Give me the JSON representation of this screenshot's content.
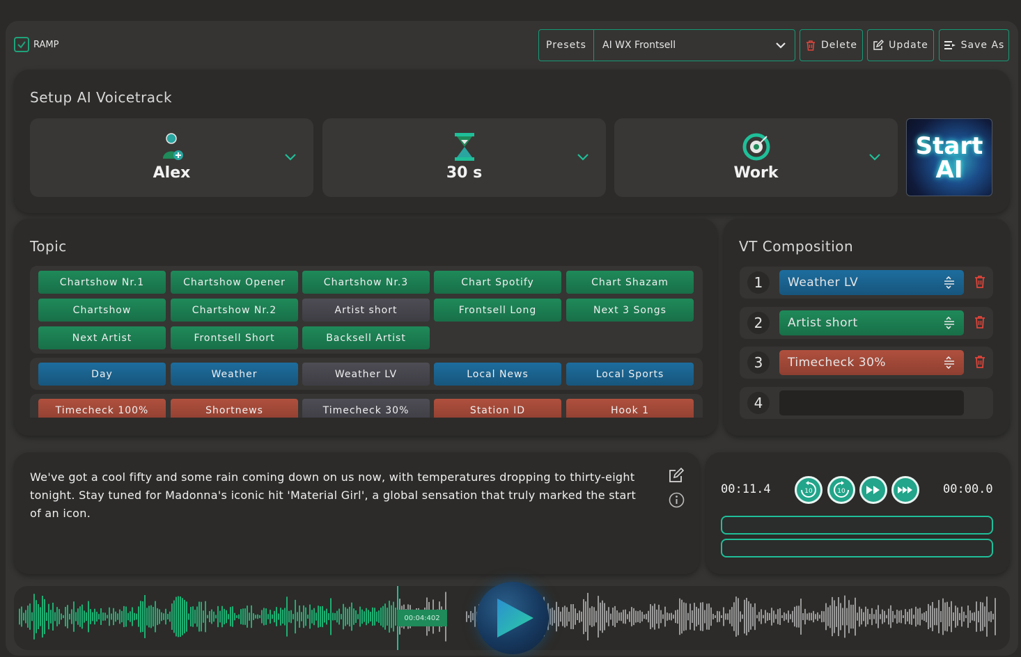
{
  "toolbar": {
    "ramp_label": "RAMP",
    "ramp_checked": true,
    "presets_label": "Presets",
    "preset_value": "AI WX Frontsell",
    "delete_label": "Delete",
    "update_label": "Update",
    "save_as_label": "Save As"
  },
  "setup": {
    "title": "Setup AI Voicetrack",
    "voice": "Alex",
    "duration": "30 s",
    "mood": "Work",
    "start_line1": "Start",
    "start_line2": "AI"
  },
  "topic": {
    "title": "Topic",
    "rows": [
      [
        "Chartshow Nr.1",
        "Chartshow Opener",
        "Chartshow Nr.3",
        "Chart Spotify",
        "Chart Shazam"
      ],
      [
        "Chartshow",
        "Chartshow Nr.2",
        "Artist short",
        "Frontsell Long",
        "Next 3 Songs"
      ],
      [
        "Next Artist",
        "Frontsell Short",
        "Backsell Artist"
      ],
      [
        "Day",
        "Weather",
        "Weather LV",
        "Local News",
        "Local Sports"
      ],
      [
        "Timecheck 100%",
        "Shortnews",
        "Timecheck 30%",
        "Station ID",
        "Hook 1"
      ]
    ]
  },
  "composition": {
    "title": "VT Composition",
    "items": [
      {
        "num": "1",
        "label": "Weather LV",
        "color": "#1d6d9e"
      },
      {
        "num": "2",
        "label": "Artist short",
        "color": "#1f8a5a"
      },
      {
        "num": "3",
        "label": "Timecheck 30%",
        "color": "#b0503e"
      },
      {
        "num": "4",
        "label": "",
        "color": ""
      }
    ]
  },
  "script_text": "We've got a cool fifty and some rain coming down on us now, with temperatures dropping to thirty-eight tonight. Stay tuned for Madonna's iconic hit 'Material Girl', a global sensation that truly marked the start of an icon.",
  "player": {
    "elapsed": "00:11.4",
    "remaining": "00:00.0",
    "skip_back_label": "10",
    "skip_fwd_label": "10"
  },
  "waveform": {
    "timecode": "00:04:402"
  },
  "colors": {
    "accent": "#159a78",
    "green": "#1f8a5a",
    "blue": "#1d6d9e",
    "red": "#b0503e",
    "neutral": "#4e4d55",
    "trash": "#e0443a"
  }
}
